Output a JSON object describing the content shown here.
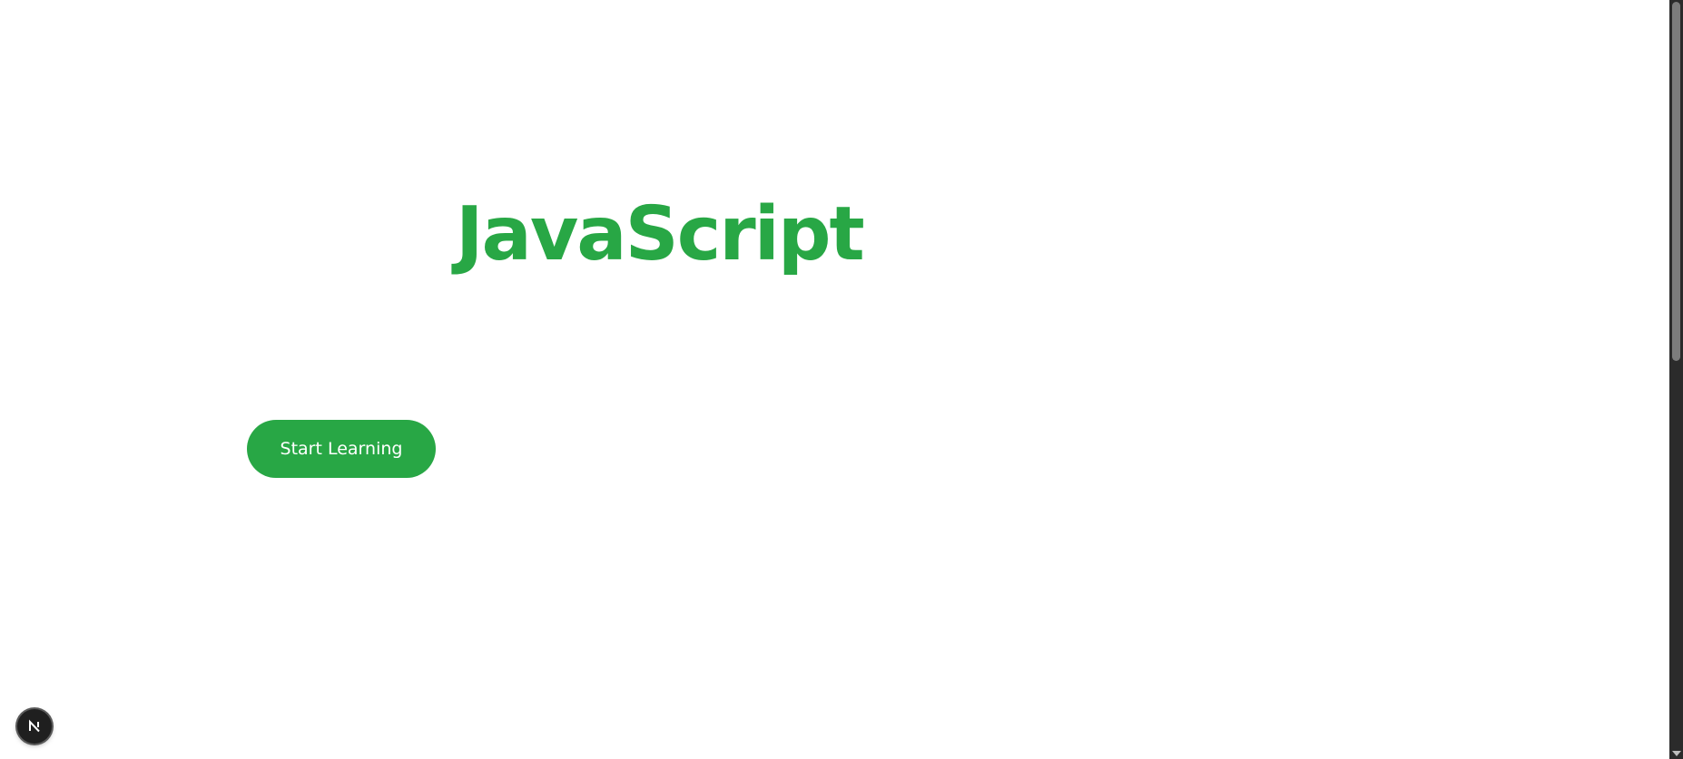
{
  "hero": {
    "title": "JavaScript"
  },
  "cta": {
    "label": "Start Learning"
  },
  "dev_badge": {
    "letter": "N",
    "icon": "nextjs-logo-icon"
  },
  "colors": {
    "accent": "#28a745",
    "background": "#ffffff",
    "badge": "#1f1f1f",
    "scrollbar": "#2b2b2b"
  }
}
